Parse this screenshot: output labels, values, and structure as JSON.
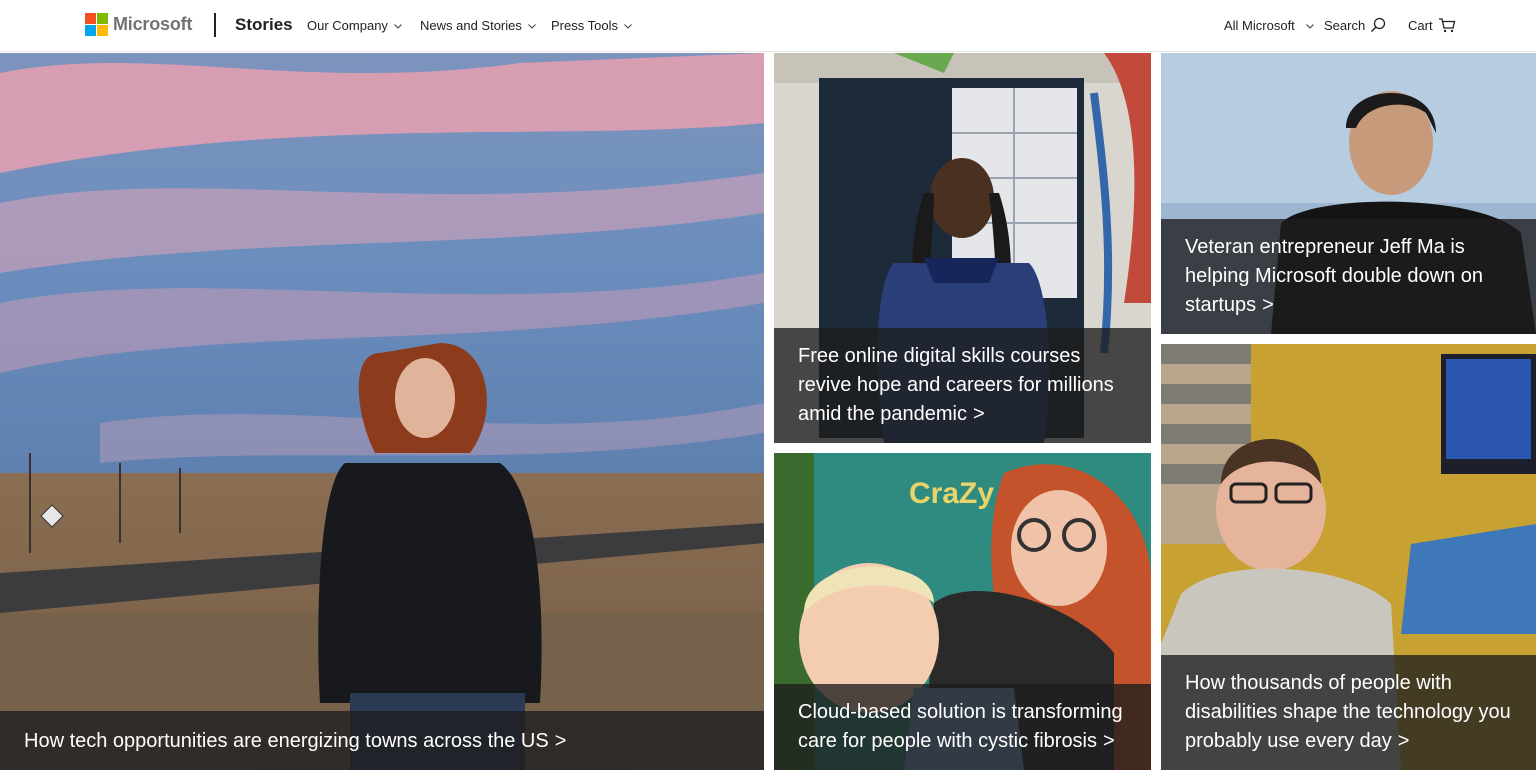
{
  "header": {
    "brand": "Microsoft",
    "section": "Stories",
    "nav": [
      "Our Company",
      "News and Stories",
      "Press Tools"
    ],
    "all_microsoft": "All Microsoft",
    "search": "Search",
    "cart": "Cart"
  },
  "logo_colors": [
    "#f25022",
    "#7fba00",
    "#00a4ef",
    "#ffb900"
  ],
  "tiles": [
    {
      "caption": "How tech opportunities are energizing towns across the US",
      "arrow": ">"
    },
    {
      "caption": "Free online digital skills courses revive hope and careers for millions amid the pandemic",
      "arrow": ">"
    },
    {
      "caption": "Veteran entrepreneur Jeff Ma is helping Microsoft double down on startups",
      "arrow": ">"
    },
    {
      "caption": "Cloud-based solution is transforming care for people with cystic fibrosis",
      "arrow": ">"
    },
    {
      "caption": "How thousands of people with disabilities shape the technology you probably use every day",
      "arrow": ">"
    }
  ],
  "photo_text": {
    "crazy_sign": "CraZy"
  }
}
